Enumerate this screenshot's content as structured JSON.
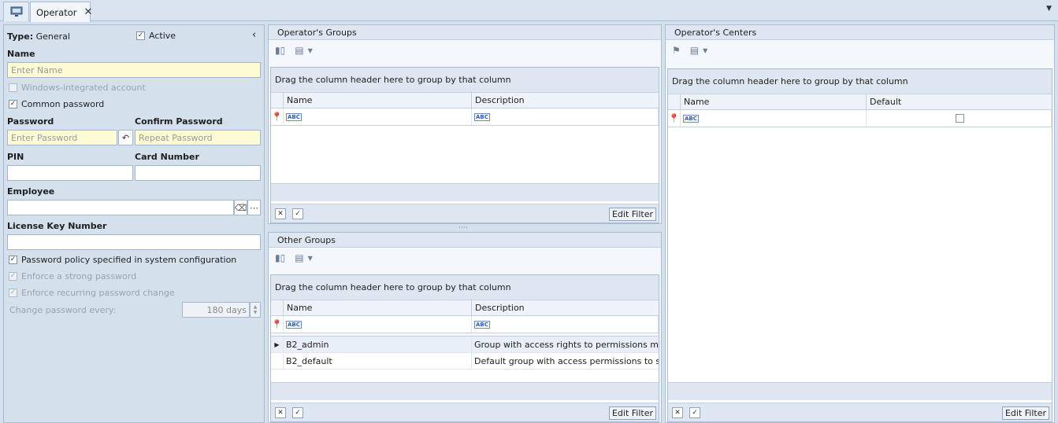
{
  "tab": {
    "label": "Operator"
  },
  "form": {
    "type_label": "Type:",
    "type_value": "General",
    "active_label": "Active",
    "name_label": "Name",
    "name_placeholder": "Enter Name",
    "windows_integrated_label": "Windows-integrated account",
    "common_password_label": "Common password",
    "password_label": "Password",
    "confirm_password_label": "Confirm Password",
    "password_placeholder": "Enter Password",
    "confirm_placeholder": "Repeat Password",
    "pin_label": "PIN",
    "card_number_label": "Card Number",
    "employee_label": "Employee",
    "license_label": "License Key Number",
    "policy_label": "Password policy specified in system configuration",
    "strong_label": "Enforce a strong password",
    "recurring_label": "Enforce recurring password change",
    "change_every_label": "Change password every:",
    "change_every_value": "180 days"
  },
  "groups": {
    "title": "Operator's Groups",
    "drag_hint": "Drag the column header here to group by that column",
    "columns": [
      "Name",
      "Description"
    ],
    "edit_filter": "Edit Filter"
  },
  "other_groups": {
    "title": "Other Groups",
    "drag_hint": "Drag the column header here to group by that column",
    "columns": [
      "Name",
      "Description"
    ],
    "rows": [
      {
        "name": "B2_admin",
        "description": "Group with access rights to permissions ma..."
      },
      {
        "name": "B2_default",
        "description": "Default group with access permissions to s..."
      }
    ],
    "edit_filter": "Edit Filter"
  },
  "centers": {
    "title": "Operator's Centers",
    "drag_hint": "Drag the column header here to group by that column",
    "columns": [
      "Name",
      "Default"
    ],
    "edit_filter": "Edit Filter"
  },
  "icons": {
    "abc": "ABC"
  }
}
